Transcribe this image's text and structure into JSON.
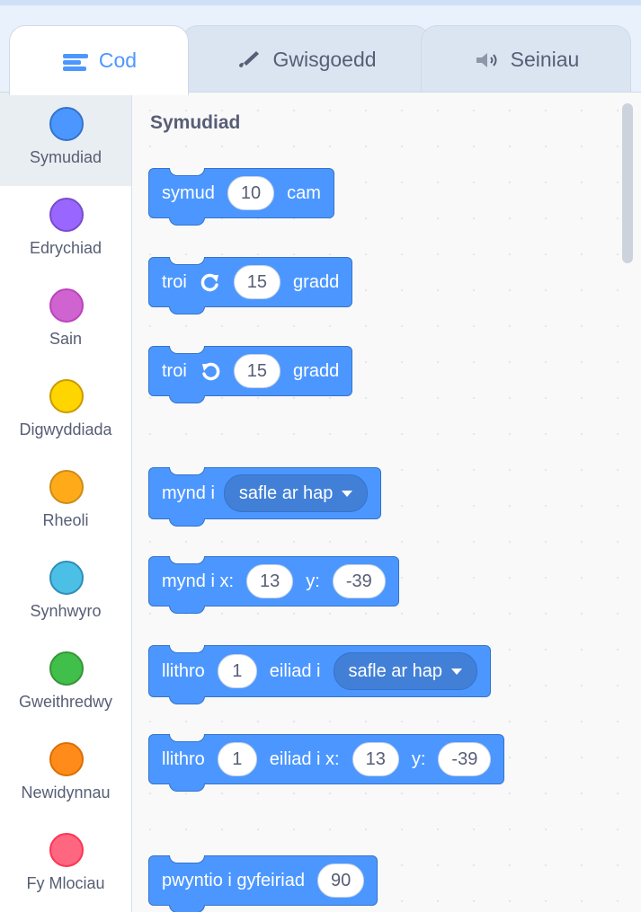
{
  "tabs": {
    "code": {
      "label": "Cod",
      "icon": "code-icon"
    },
    "costumes": {
      "label": "Gwisgoedd",
      "icon": "paintbrush-icon"
    },
    "sounds": {
      "label": "Seiniau",
      "icon": "speaker-icon"
    }
  },
  "categories": [
    {
      "label": "Symudiad",
      "color": "#4c97ff"
    },
    {
      "label": "Edrychiad",
      "color": "#9966ff"
    },
    {
      "label": "Sain",
      "color": "#cf63cf"
    },
    {
      "label": "Digwyddiada",
      "color": "#ffd500"
    },
    {
      "label": "Rheoli",
      "color": "#ffab19"
    },
    {
      "label": "Synhwyro",
      "color": "#4cbfe6"
    },
    {
      "label": "Gweithredwy",
      "color": "#40bf4a"
    },
    {
      "label": "Newidynnau",
      "color": "#ff8c1a"
    },
    {
      "label": "Fy Mlociau",
      "color": "#ff6680"
    }
  ],
  "section_title": "Symudiad",
  "blocks": {
    "move": {
      "a": "symud",
      "v": "10",
      "b": "cam"
    },
    "turn_right": {
      "a": "troi",
      "v": "15",
      "b": "gradd",
      "icon": "rotate-right-icon"
    },
    "turn_left": {
      "a": "troi",
      "v": "15",
      "b": "gradd",
      "icon": "rotate-left-icon"
    },
    "goto": {
      "a": "mynd i",
      "menu": "safle ar hap"
    },
    "goto_xy": {
      "a": "mynd i x:",
      "x": "13",
      "b": "y:",
      "y": "-39"
    },
    "glide": {
      "a": "llithro",
      "v": "1",
      "b": "eiliad i",
      "menu": "safle ar hap"
    },
    "glide_xy": {
      "a": "llithro",
      "v": "1",
      "b": "eiliad i x:",
      "x": "13",
      "c": "y:",
      "y": "-39"
    },
    "point": {
      "a": "pwyntio i gyfeiriad",
      "v": "90"
    }
  },
  "colors": {
    "motion": "#4c97ff",
    "motion_dark": "#3373cc",
    "accent": "#4c97ff"
  }
}
